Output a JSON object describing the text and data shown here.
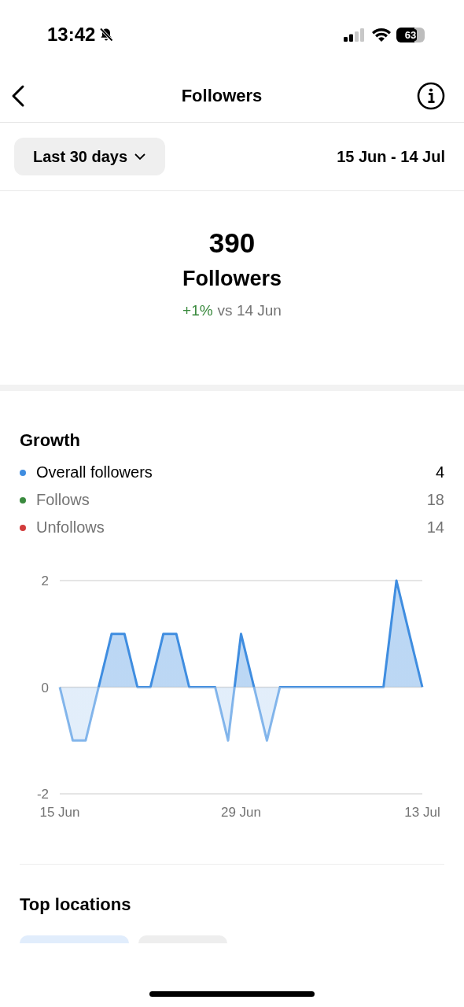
{
  "status_bar": {
    "time": "13:42",
    "battery": "63"
  },
  "header": {
    "title": "Followers"
  },
  "filter": {
    "range": "Last 30 days",
    "dates": "15 Jun - 14 Jul"
  },
  "summary": {
    "count": "390",
    "label": "Followers",
    "change": "+1%",
    "comparison": "vs 14 Jun"
  },
  "growth": {
    "title": "Growth",
    "legend": [
      {
        "label": "Overall followers",
        "value": "4",
        "color": "#3f8de0",
        "selected": true
      },
      {
        "label": "Follows",
        "value": "18",
        "color": "#3a8a3e",
        "selected": false
      },
      {
        "label": "Unfollows",
        "value": "14",
        "color": "#d23c3c",
        "selected": false
      }
    ],
    "chart_data": {
      "type": "area",
      "categories": [
        "15 Jun",
        null,
        null,
        null,
        null,
        null,
        null,
        null,
        null,
        null,
        null,
        null,
        null,
        null,
        "29 Jun",
        null,
        null,
        null,
        null,
        null,
        null,
        null,
        null,
        null,
        null,
        null,
        null,
        null,
        "13 Jul"
      ],
      "series": [
        {
          "color": "#3f8de0",
          "values": [
            0,
            -1,
            -1,
            0,
            1,
            1,
            0,
            0,
            1,
            1,
            0,
            0,
            0,
            -1,
            1,
            0,
            -1,
            0,
            0,
            0,
            0,
            0,
            0,
            0,
            0,
            0,
            2,
            1,
            0
          ]
        }
      ],
      "ylim": [
        -2,
        2
      ],
      "yticks": [
        -2,
        0,
        2
      ]
    }
  },
  "top_locations": {
    "title": "Top locations",
    "tabs": [
      {
        "selected": true
      },
      {
        "selected": false
      }
    ]
  }
}
